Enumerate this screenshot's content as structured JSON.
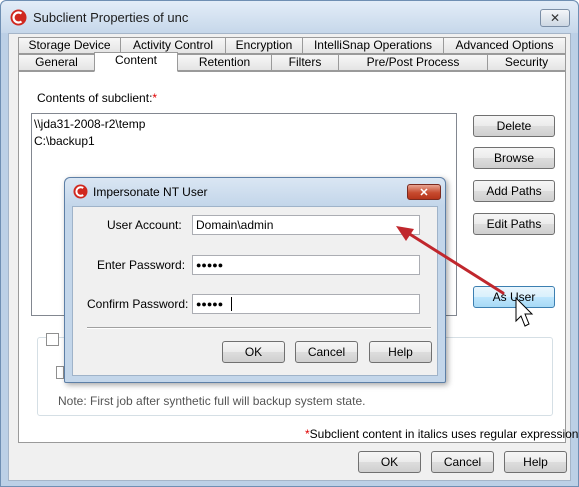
{
  "window": {
    "title": "Subclient Properties of unc",
    "close_glyph": "✕",
    "icon": "commvault-app-icon"
  },
  "tabs_row1": [
    "Storage Device",
    "Activity Control",
    "Encryption",
    "IntelliSnap Operations",
    "Advanced Options"
  ],
  "tabs_row2": [
    "General",
    "Content",
    "Retention",
    "Filters",
    "Pre/Post Process",
    "Security"
  ],
  "active_tab": "Content",
  "content": {
    "label": "Contents of subclient:",
    "required_mark": "*",
    "items": [
      "\\\\jda31-2008-r2\\temp",
      "C:\\backup1"
    ]
  },
  "side_buttons": {
    "delete": "Delete",
    "browse": "Browse",
    "add_paths": "Add Paths",
    "edit_paths": "Edit Paths",
    "as_user": "As User"
  },
  "note": "Note: First job after synthetic full will backup system state.",
  "footer_note": {
    "mark": "*",
    "text": "Subclient content in italics uses regular expressions"
  },
  "bottom_buttons": {
    "ok": "OK",
    "cancel": "Cancel",
    "help": "Help"
  },
  "dialog": {
    "title": "Impersonate NT User",
    "close_glyph": "✕",
    "user_account_label": "User Account:",
    "user_account_value": "Domain\\admin",
    "enter_password_label": "Enter Password:",
    "enter_password_value": "●●●●●",
    "confirm_password_label": "Confirm Password:",
    "confirm_password_value": "●●●●●",
    "ok": "OK",
    "cancel": "Cancel",
    "help": "Help"
  },
  "colors": {
    "accent_arrow": "#c0272d",
    "required": "#e00000",
    "hover_button": "#bee6fd"
  }
}
